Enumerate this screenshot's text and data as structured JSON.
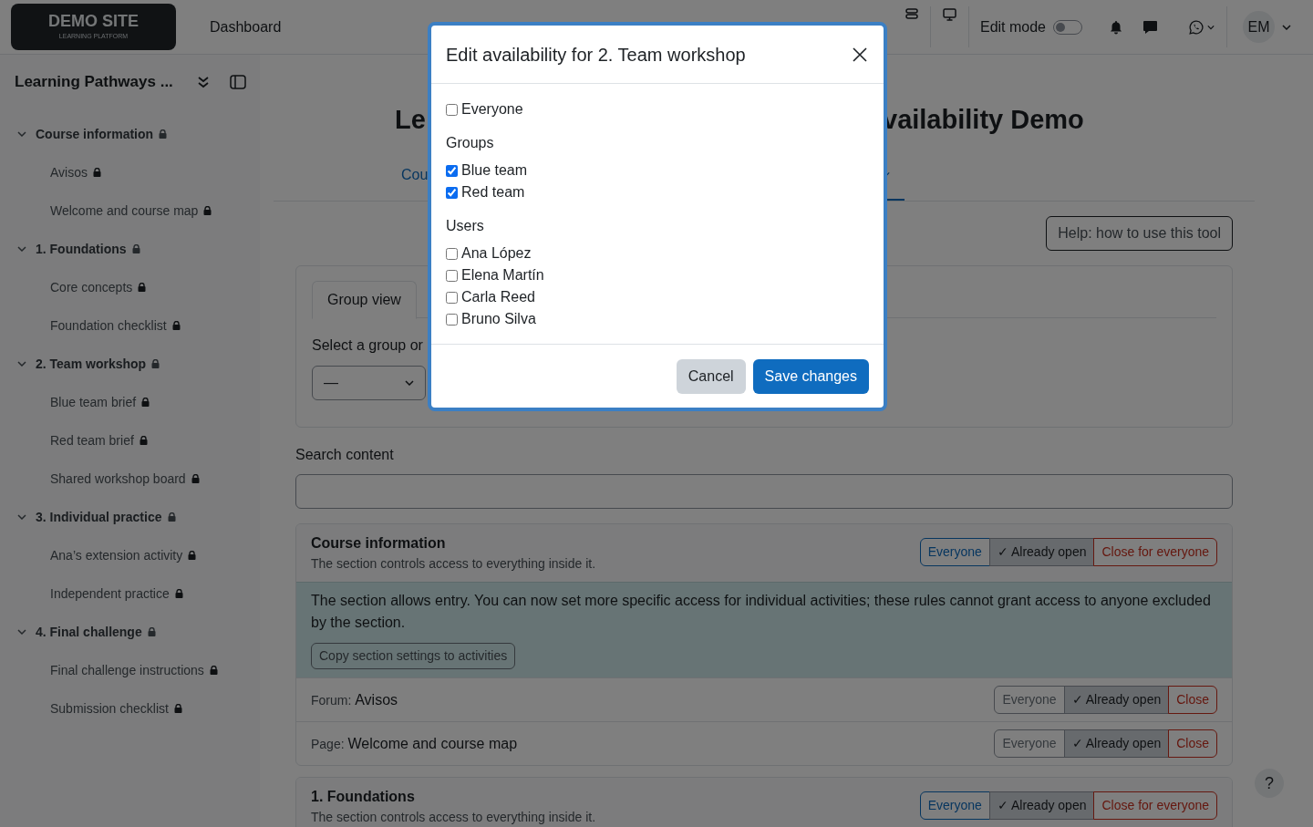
{
  "header": {
    "logo_title": "DEMO SITE",
    "logo_subtitle": "LEARNING PLATFORM",
    "nav": [
      {
        "label": "Dashboard"
      }
    ],
    "edit_mode": {
      "label": "Edit mode",
      "on": false
    },
    "avatar": "EM"
  },
  "sidebar": {
    "title": "Learning Pathways ...",
    "sections": [
      {
        "label": "Course information",
        "expanded": true,
        "children": [
          {
            "label": "Avisos"
          },
          {
            "label": "Welcome and course map"
          }
        ]
      },
      {
        "label": "1. Foundations",
        "expanded": true,
        "children": [
          {
            "label": "Core concepts"
          },
          {
            "label": "Foundation checklist"
          }
        ]
      },
      {
        "label": "2. Team workshop",
        "expanded": true,
        "children": [
          {
            "label": "Blue team brief"
          },
          {
            "label": "Red team brief"
          },
          {
            "label": "Shared workshop board"
          }
        ]
      },
      {
        "label": "3. Individual practice",
        "expanded": true,
        "children": [
          {
            "label": "Ana’s extension activity"
          },
          {
            "label": "Independent practice"
          }
        ]
      },
      {
        "label": "4. Final challenge",
        "expanded": true,
        "children": [
          {
            "label": "Final challenge instructions"
          },
          {
            "label": "Submission checklist"
          }
        ]
      }
    ]
  },
  "page": {
    "title_parts": [
      "Le",
      "vailability Demo"
    ],
    "tabs": [
      {
        "kind": "text",
        "label": "Cou",
        "selected": false
      },
      {
        "kind": "dropdown",
        "selected": true
      }
    ],
    "help_button": "Help: how to use this tool",
    "view_tabs": [
      {
        "label": "Group view",
        "selected": true
      }
    ],
    "group_select": {
      "label": "Select a group or",
      "value": "—"
    },
    "search": {
      "label": "Search content"
    },
    "sections": [
      {
        "title": "Course information",
        "subtitle": "The section controls access to everything inside it.",
        "options": [
          {
            "kind": "everyone",
            "label": "Everyone",
            "selected": false
          },
          {
            "kind": "open",
            "label": "✓ Already open",
            "selected": true
          },
          {
            "kind": "close",
            "label": "Close for everyone",
            "selected": false
          }
        ],
        "notice": "The section allows entry. You can now set more specific access for individual activities; these rules cannot grant access to anyone excluded by the section.",
        "copy_button": "Copy section settings to activities",
        "activities": [
          {
            "type": "Forum:",
            "name": "Avisos",
            "options": [
              {
                "kind": "everyone",
                "label": "Everyone",
                "selected": false
              },
              {
                "kind": "open",
                "label": "✓ Already open",
                "selected": true
              },
              {
                "kind": "close",
                "label": "Close",
                "selected": false
              }
            ]
          },
          {
            "type": "Page:",
            "name": "Welcome and course map",
            "options": [
              {
                "kind": "everyone",
                "label": "Everyone",
                "selected": false
              },
              {
                "kind": "open",
                "label": "✓ Already open",
                "selected": true
              },
              {
                "kind": "close",
                "label": "Close",
                "selected": false
              }
            ]
          }
        ]
      },
      {
        "title": "1. Foundations",
        "subtitle": "The section controls access to everything inside it.",
        "options": [
          {
            "kind": "everyone",
            "label": "Everyone",
            "selected": false
          },
          {
            "kind": "open",
            "label": "✓ Already open",
            "selected": true
          },
          {
            "kind": "close",
            "label": "Close for everyone",
            "selected": false
          }
        ]
      }
    ]
  },
  "help_fab": "?",
  "modal": {
    "title": "Edit availability for 2. Team workshop",
    "everyone": {
      "label": "Everyone",
      "checked": false
    },
    "groups_label": "Groups",
    "groups": [
      {
        "label": "Blue team",
        "checked": true
      },
      {
        "label": "Red team",
        "checked": true
      }
    ],
    "users_label": "Users",
    "users": [
      {
        "label": "Ana López",
        "checked": false
      },
      {
        "label": "Elena Martín",
        "checked": false
      },
      {
        "label": "Carla Reed",
        "checked": false
      },
      {
        "label": "Bruno Silva",
        "checked": false
      }
    ],
    "buttons": [
      {
        "kind": "secondary",
        "label": "Cancel"
      },
      {
        "kind": "primary",
        "label": "Save changes"
      }
    ]
  }
}
